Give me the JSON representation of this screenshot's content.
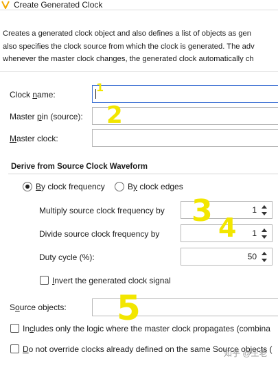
{
  "window": {
    "title": "Create Generated Clock"
  },
  "description": {
    "line1": "Creates a generated clock object and also defines a list of objects as gen",
    "line2": "also specifies the clock source from which the clock is generated. The adv",
    "line3": "whenever the master clock changes, the generated clock automatically ch"
  },
  "fields": {
    "clock_name": {
      "label_pre": "Clock ",
      "label_u": "n",
      "label_post": "ame:",
      "value": ""
    },
    "master_pin": {
      "label_pre": "Master ",
      "label_u": "p",
      "label_post": "in (source):",
      "value": ""
    },
    "master_clock": {
      "label_pre": "",
      "label_u": "M",
      "label_post": "aster clock:",
      "value": ""
    }
  },
  "derive": {
    "title": "Derive from Source Clock Waveform",
    "radio_frequency": {
      "label_u": "B",
      "label_rest": "y clock frequency",
      "selected": true
    },
    "radio_edges": {
      "label_pre": "B",
      "label_u": "y",
      "label_rest": " clock edges",
      "selected": false
    },
    "multiply": {
      "label": "Multiply source clock frequency by",
      "value": "1"
    },
    "divide": {
      "label": "Divide source clock frequency by",
      "value": "1"
    },
    "duty": {
      "label": "Duty cycle (%):",
      "value": "50"
    },
    "invert": {
      "label_u": "I",
      "label_rest": "nvert the generated clock signal",
      "checked": false
    }
  },
  "source_objects": {
    "label_pre": "S",
    "label_u": "o",
    "label_post": "urce objects:",
    "value": ""
  },
  "checks": {
    "includes": {
      "label_pre": "In",
      "label_u": "c",
      "label_rest": "ludes only the logic where the master clock propagates (combina",
      "checked": false
    },
    "override": {
      "label_u": "D",
      "label_rest": "o not override clocks already defined on the same Source objects (",
      "checked": false
    }
  },
  "annotations": [
    "1",
    "2",
    "3",
    "4",
    "5"
  ],
  "watermark": "知乎 @王老",
  "colors": {
    "annotation": "#f2e600",
    "focus_border": "#3b6fd3"
  }
}
